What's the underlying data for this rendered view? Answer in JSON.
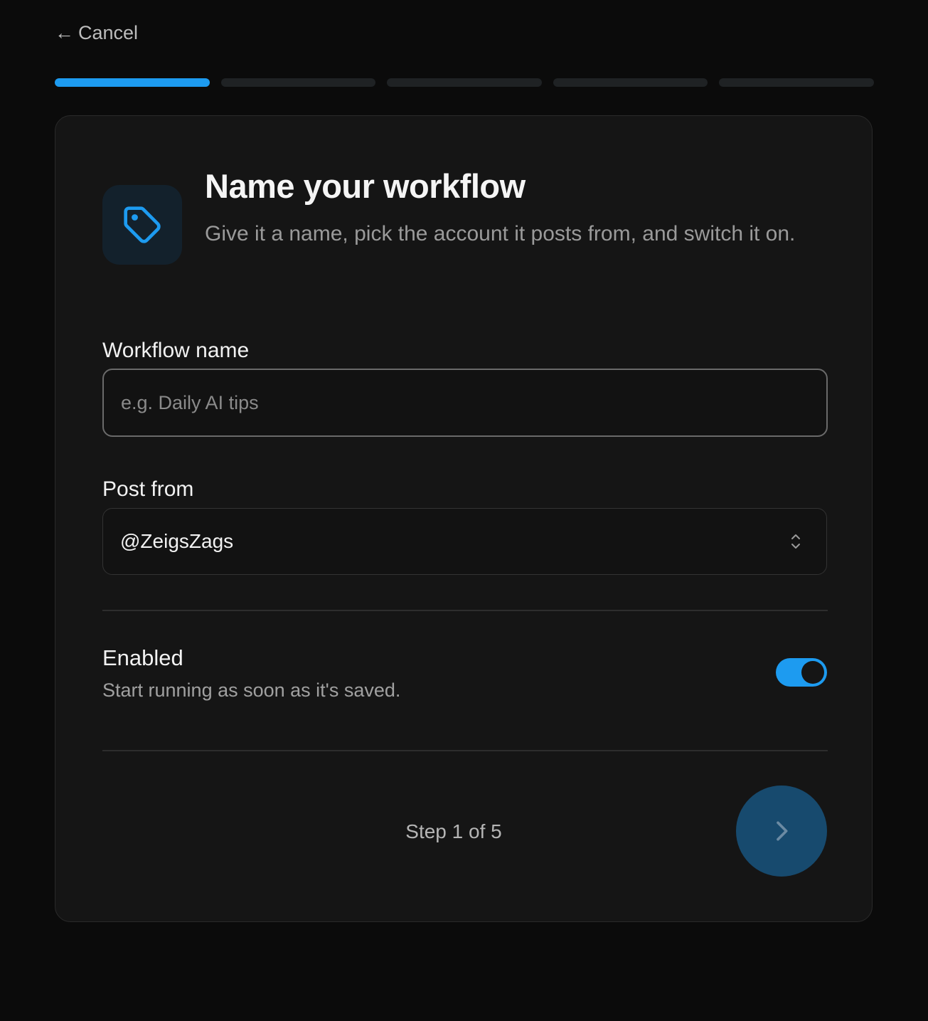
{
  "nav": {
    "cancel_arrow": "←",
    "cancel_label": "Cancel"
  },
  "progress": {
    "total_steps": 5,
    "current_step": 1,
    "active_color": "#1d9bf0",
    "inactive_color": "#1f2224"
  },
  "header": {
    "icon": "tag-icon",
    "title": "Name your workflow",
    "subtitle": "Give it a name, pick the account it posts from, and switch it on."
  },
  "form": {
    "workflow_name": {
      "label": "Workflow name",
      "value": "",
      "placeholder": "e.g. Daily AI tips"
    },
    "post_from": {
      "label": "Post from",
      "selected": "@ZeigsZags",
      "icon": "chevron-up-down-icon"
    },
    "enabled": {
      "label": "Enabled",
      "description": "Start running as soon as it's saved.",
      "on": true
    }
  },
  "footer": {
    "step_text": "Step 1 of 5",
    "next_icon": "chevron-right-icon",
    "next_button_color": "#174a6e"
  },
  "colors": {
    "accent": "#1d9bf0",
    "background": "#0b0b0b",
    "card": "#151515"
  }
}
